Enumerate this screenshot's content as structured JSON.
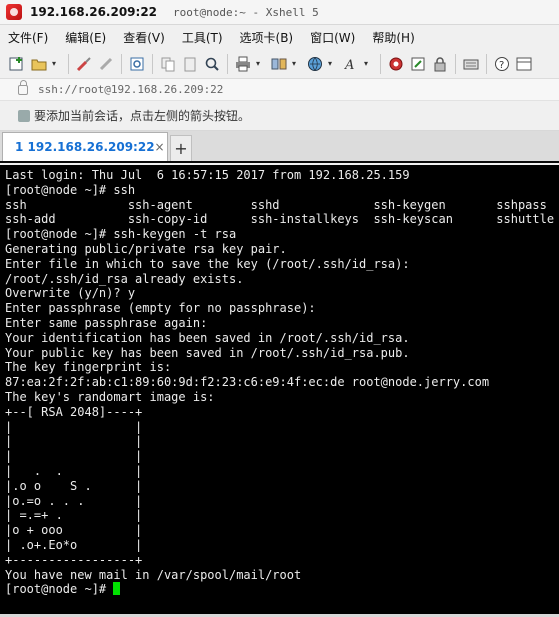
{
  "window": {
    "host": "192.168.26.209:22",
    "title_rest": "root@node:~ - Xshell 5"
  },
  "menu": [
    {
      "label": "文件(F)"
    },
    {
      "label": "编辑(E)"
    },
    {
      "label": "查看(V)"
    },
    {
      "label": "工具(T)"
    },
    {
      "label": "选项卡(B)"
    },
    {
      "label": "窗口(W)"
    },
    {
      "label": "帮助(H)"
    }
  ],
  "address": {
    "value": "ssh://root@192.168.26.209:22"
  },
  "infobar": {
    "text": "要添加当前会话，点击左侧的箭头按钮。"
  },
  "tabs": [
    {
      "label": "1 192.168.26.209:22",
      "status_color": "#1ec51e",
      "close": "×"
    }
  ],
  "new_tab_label": "+",
  "terminal": {
    "lines": [
      "Last login: Thu Jul  6 16:57:15 2017 from 192.168.25.159",
      "[root@node ~]# ssh",
      "ssh              ssh-agent        sshd             ssh-keygen       sshpass",
      "ssh-add          ssh-copy-id      ssh-installkeys  ssh-keyscan      sshuttle",
      "[root@node ~]# ssh-keygen -t rsa",
      "Generating public/private rsa key pair.",
      "Enter file in which to save the key (/root/.ssh/id_rsa):",
      "/root/.ssh/id_rsa already exists.",
      "Overwrite (y/n)? y",
      "Enter passphrase (empty for no passphrase):",
      "Enter same passphrase again:",
      "Your identification has been saved in /root/.ssh/id_rsa.",
      "Your public key has been saved in /root/.ssh/id_rsa.pub.",
      "The key fingerprint is:",
      "87:ea:2f:2f:ab:c1:89:60:9d:f2:23:c6:e9:4f:ec:de root@node.jerry.com",
      "The key's randomart image is:",
      "+--[ RSA 2048]----+",
      "|                 |",
      "|                 |",
      "|                 |",
      "|   .  .          |",
      "|.o o    S .      |",
      "|o.=o . . .       |",
      "| =.=+ .          |",
      "|o + ooo          |",
      "| .o+.Eo*o        |",
      "+-----------------+",
      "You have new mail in /var/spool/mail/root"
    ],
    "prompt": "[root@node ~]# ",
    "cursor_color": "#00e000"
  }
}
